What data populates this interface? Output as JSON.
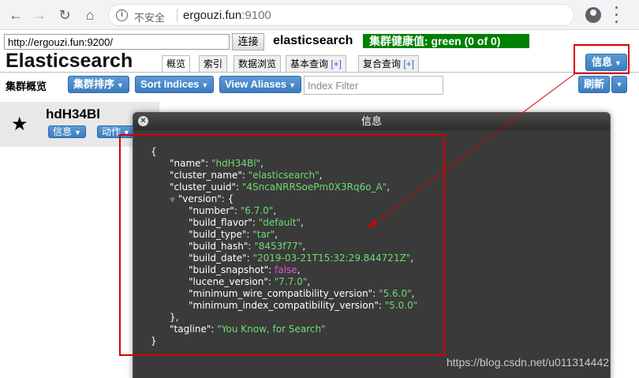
{
  "browser": {
    "insecure_label": "不安全",
    "url_host": "ergouzi.fun",
    "url_port": ":9100"
  },
  "header": {
    "connect_url": "http://ergouzi.fun:9200/",
    "connect_button": "连接",
    "cluster_name": "elasticsearch",
    "cluster_health": "集群健康值: green (0 of 0)",
    "app_title": "Elasticsearch",
    "info_button": "信息",
    "tabs": [
      {
        "label": "概览",
        "plus": ""
      },
      {
        "label": "索引",
        "plus": ""
      },
      {
        "label": "数据浏览",
        "plus": ""
      },
      {
        "label": "基本查询 ",
        "plus": "[+]"
      },
      {
        "label": "复合查询 ",
        "plus": "[+]"
      }
    ]
  },
  "toolbar": {
    "title": "集群概览",
    "cluster_sort": "集群排序",
    "sort_indices": "Sort Indices",
    "view_aliases": "View Aliases",
    "index_filter_placeholder": "Index Filter",
    "refresh": "刷新"
  },
  "node": {
    "name": "hdH34Bl",
    "info_button": "信息",
    "actions_button": "动作"
  },
  "dialog": {
    "title": "信息",
    "json": {
      "open_brace": "{",
      "close_brace": "}",
      "name_key": "\"name\"",
      "name_val": "\"hdH34Bl\"",
      "cluster_name_key": "\"cluster_name\"",
      "cluster_name_val": "\"elasticsearch\"",
      "cluster_uuid_key": "\"cluster_uuid\"",
      "cluster_uuid_val": "\"4SncaNRRSoePm0X3Rq6o_A\"",
      "version_key": "\"version\"",
      "number_key": "\"number\"",
      "number_val": "\"6.7.0\"",
      "build_flavor_key": "\"build_flavor\"",
      "build_flavor_val": "\"default\"",
      "build_type_key": "\"build_type\"",
      "build_type_val": "\"tar\"",
      "build_hash_key": "\"build_hash\"",
      "build_hash_val": "\"8453f77\"",
      "build_date_key": "\"build_date\"",
      "build_date_val": "\"2019-03-21T15:32:29.844721Z\"",
      "build_snapshot_key": "\"build_snapshot\"",
      "build_snapshot_val": "false",
      "lucene_version_key": "\"lucene_version\"",
      "lucene_version_val": "\"7.7.0\"",
      "min_wire_key": "\"minimum_wire_compatibility_version\"",
      "min_wire_val": "\"5.6.0\"",
      "min_index_key": "\"minimum_index_compatibility_version\"",
      "min_index_val": "\"5.0.0\"",
      "tagline_key": "\"tagline\"",
      "tagline_val": "\"You Know, for Search\""
    }
  },
  "watermark": "https://blog.csdn.net/u011314442",
  "colors": {
    "health_green": "#008000",
    "button_blue": "#4a8ac9",
    "json_string": "#6fdc6f",
    "json_boolean": "#dd55dd",
    "annotation_red": "#d40000"
  }
}
